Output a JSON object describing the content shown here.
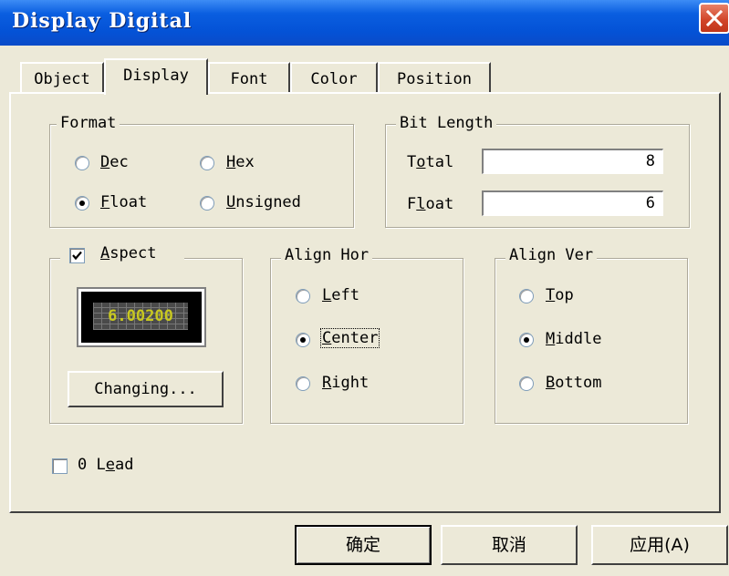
{
  "window": {
    "title": "Display Digital",
    "close_icon": "close-icon"
  },
  "tabs": [
    {
      "label": "Object",
      "active": false
    },
    {
      "label": "Display",
      "active": true
    },
    {
      "label": "Font",
      "active": false
    },
    {
      "label": "Color",
      "active": false
    },
    {
      "label": "Position",
      "active": false
    }
  ],
  "format": {
    "legend": "Format",
    "dec": {
      "accel": "D",
      "rest": "ec",
      "checked": false
    },
    "hex": {
      "accel": "H",
      "rest": "ex",
      "checked": false
    },
    "float": {
      "accel": "F",
      "rest": "loat",
      "checked": true
    },
    "unsigned": {
      "accel": "U",
      "rest": "nsigned",
      "checked": false
    }
  },
  "bit_length": {
    "legend": "Bit Length",
    "total_pre": "T",
    "total_accel": "o",
    "total_rest": "tal",
    "total_value": "8",
    "float_pre": "F",
    "float_accel": "l",
    "float_rest": "oat",
    "float_value": "6"
  },
  "aspect": {
    "checked": true,
    "accel": "A",
    "rest": "spect",
    "preview_text": "6.00200",
    "changing_button": "Changing..."
  },
  "align_hor": {
    "legend": "Align Hor",
    "left": {
      "accel": "L",
      "rest": "eft",
      "checked": false
    },
    "center": {
      "accel": "C",
      "rest": "enter",
      "checked": true
    },
    "right": {
      "accel": "R",
      "rest": "ight",
      "checked": false
    }
  },
  "align_ver": {
    "legend": "Align Ver",
    "top": {
      "accel": "T",
      "rest": "op",
      "checked": false
    },
    "middle": {
      "accel": "M",
      "rest": "iddle",
      "checked": true
    },
    "bottom": {
      "accel": "B",
      "rest": "ottom",
      "checked": false
    }
  },
  "zero_lead": {
    "checked": false,
    "pre": "0 L",
    "accel": "e",
    "rest": "ad"
  },
  "buttons": {
    "ok": "确定",
    "cancel": "取消",
    "apply": "应用(A)"
  },
  "colors": {
    "title_bar": "#0452d6",
    "dialog_bg": "#ece9d8",
    "close_button": "#d2462a",
    "preview_text": "#c8c820"
  }
}
